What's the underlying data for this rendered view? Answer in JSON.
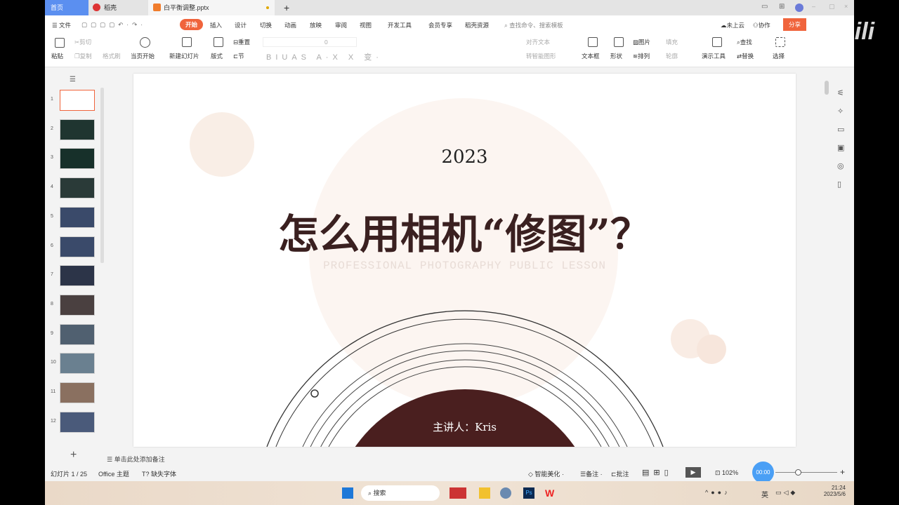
{
  "tabs": [
    {
      "label": "首页"
    },
    {
      "label": "稻壳"
    },
    {
      "label": "白平衡调整.pptx"
    }
  ],
  "menu": {
    "file": "文件",
    "items": [
      "开始",
      "插入",
      "设计",
      "切换",
      "动画",
      "放映",
      "审阅",
      "视图",
      "开发工具",
      "会员专享",
      "稻壳资源"
    ],
    "search_placeholder": "查找命令、搜索模板",
    "cloud": "未上云",
    "collab": "协作",
    "share": "分享"
  },
  "ribbon": {
    "paste": "粘贴",
    "cut": "剪切",
    "copy": "复制",
    "format_painter": "格式刷",
    "play_current": "当页开始",
    "new_slide": "新建幻灯片",
    "layout": "版式",
    "reset": "重置",
    "section": "节",
    "font_size": "0",
    "align_text": "对齐文本",
    "smartart": "转智能图形",
    "textbox": "文本框",
    "shape": "形状",
    "picture": "图片",
    "fill": "填充",
    "arrange": "排列",
    "outline": "轮廓",
    "present_tools": "演示工具",
    "find": "查找",
    "replace": "替换",
    "select": "选择"
  },
  "slide": {
    "year": "2023",
    "title": "怎么用相机“修图”？",
    "subtitle": "PROFESSIONAL PHOTOGRAPHY PUBLIC LESSON",
    "presenter": "主讲人：Kris"
  },
  "thumbnails": [
    "1",
    "2",
    "3",
    "4",
    "5",
    "6",
    "7",
    "8",
    "9",
    "10",
    "11",
    "12"
  ],
  "notes_placeholder": "单击此处添加备注",
  "status": {
    "slide_counter": "幻灯片 1 / 25",
    "theme": "Office 主题",
    "missing_font": "缺失字体",
    "beautify": "智能美化",
    "notes": "备注",
    "comments": "批注",
    "zoom": "102%",
    "timer": "00:00"
  },
  "taskbar": {
    "search": "搜索",
    "ime": "英",
    "time": "21:24",
    "date": "2023/5/6"
  },
  "watermark": "bilibili",
  "colors": {
    "accent": "#f0643c",
    "tab_home": "#5b8ff0",
    "title": "#3a2020",
    "disc": "#4a1f1f"
  }
}
